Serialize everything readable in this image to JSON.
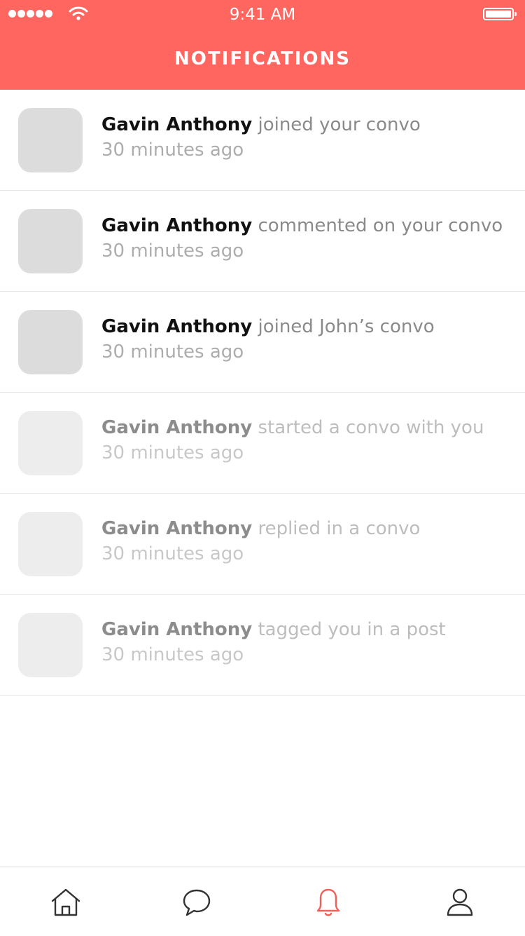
{
  "status_bar": {
    "time": "9:41 AM",
    "signal_icon": "signal-dots-icon",
    "wifi_icon": "wifi-icon",
    "battery_icon": "battery-icon"
  },
  "header": {
    "title": "NOTIFICATIONS",
    "background": "#FF6660"
  },
  "notifications": [
    {
      "name": "Gavin Anthony",
      "action": "joined your convo",
      "time": "30 minutes ago"
    },
    {
      "name": "Gavin Anthony",
      "action": "commented on your convo",
      "time": "30 minutes ago"
    },
    {
      "name": "Gavin Anthony",
      "action": "joined John’s convo",
      "time": "30 minutes ago"
    },
    {
      "name": "Gavin Anthony",
      "action": "started a convo with you",
      "time": "30 minutes ago"
    },
    {
      "name": "Gavin Anthony",
      "action": "replied in a convo",
      "time": "30 minutes ago"
    },
    {
      "name": "Gavin Anthony",
      "action": "tagged you in a post",
      "time": "30 minutes ago"
    }
  ],
  "tabbar": {
    "items": [
      {
        "icon": "home-icon"
      },
      {
        "icon": "chat-bubble-icon"
      },
      {
        "icon": "bell-icon",
        "active": true
      },
      {
        "icon": "profile-icon"
      }
    ],
    "active_color": "#F0605A",
    "inactive_color": "#333333"
  }
}
